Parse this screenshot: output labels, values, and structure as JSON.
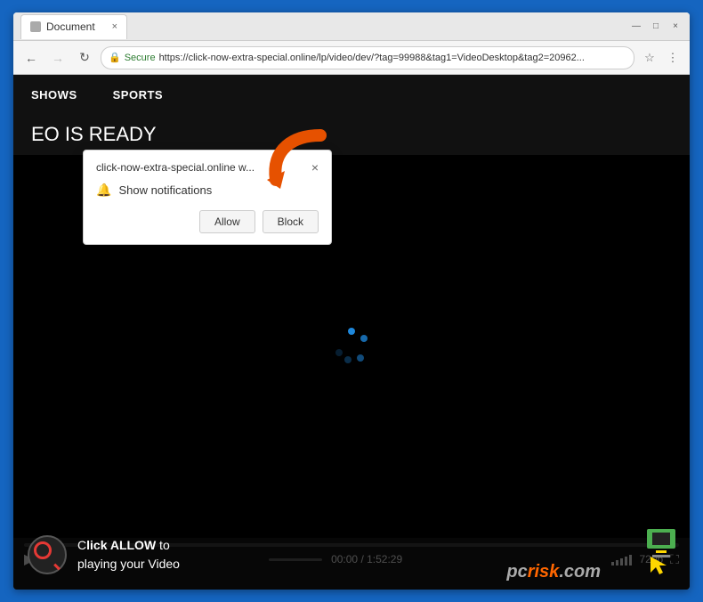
{
  "browser": {
    "tab_title": "Document",
    "tab_close": "×",
    "controls": {
      "minimize": "—",
      "maximize": "□",
      "close": "×"
    },
    "address": {
      "secure_label": "Secure",
      "url": "https://click-now-extra-special.online/lp/video/dev/?tag=99988&tag1=VideoDesktop&tag2=20962...",
      "url_short": "https://click-now-extra-special.online/lp/video/dev/?tag=99988&tag1=VideoDesktop&tag2=20962..."
    }
  },
  "site": {
    "nav_items": [
      "SHOWS",
      "SPORTS"
    ],
    "video_title": "EO IS READY"
  },
  "video": {
    "time_current": "00:00",
    "time_total": "1:52:29",
    "quality": "720p"
  },
  "notification_popup": {
    "site_name": "click-now-extra-special.online w...",
    "close_btn": "×",
    "notification_label": "Show notifications",
    "allow_btn": "Allow",
    "block_btn": "Block"
  },
  "bottom_overlay": {
    "line1": "lick ALLOW to",
    "line2": "playing your Video",
    "allow_highlight": "ALLOW",
    "pcrisk": "pcrisk.com"
  }
}
